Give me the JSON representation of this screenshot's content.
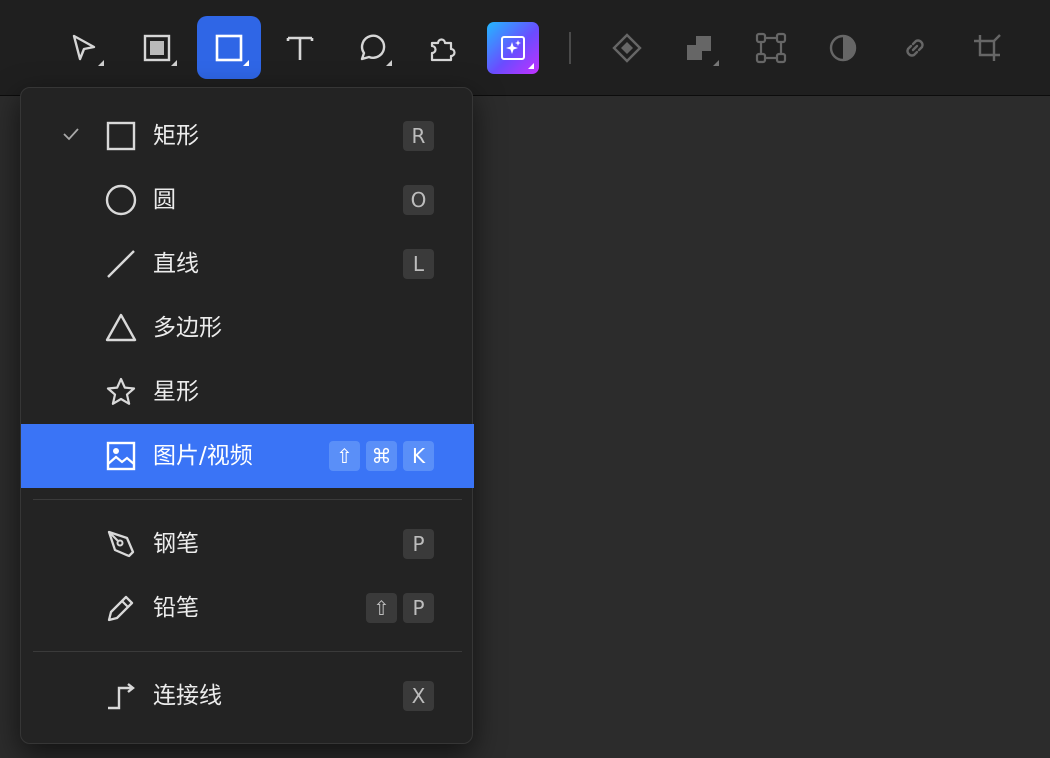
{
  "toolbar": {
    "tools": [
      {
        "name": "select-tool",
        "icon": "cursor-arrow-icon",
        "has_dropdown": true
      },
      {
        "name": "frame-tool",
        "icon": "frame-icon",
        "has_dropdown": true
      },
      {
        "name": "rectangle-tool",
        "icon": "square-icon",
        "has_dropdown": true,
        "active": true
      },
      {
        "name": "text-tool",
        "icon": "text-icon",
        "has_dropdown": false
      },
      {
        "name": "comment-tool",
        "icon": "speech-bubble-icon",
        "has_dropdown": true
      },
      {
        "name": "plugin-tool",
        "icon": "puzzle-icon",
        "has_dropdown": false
      },
      {
        "name": "ai-tool",
        "icon": "magic-sparkle-icon",
        "has_dropdown": true
      }
    ],
    "right_tools": [
      {
        "name": "component-tool",
        "icon": "diamond-icon",
        "has_dropdown": false
      },
      {
        "name": "boolean-tool",
        "icon": "boolean-union-icon",
        "has_dropdown": true
      },
      {
        "name": "vector-edit-tool",
        "icon": "bounding-box-icon",
        "has_dropdown": false
      },
      {
        "name": "mask-tool",
        "icon": "half-circle-icon",
        "has_dropdown": false
      },
      {
        "name": "link-tool",
        "icon": "link-icon",
        "has_dropdown": false
      },
      {
        "name": "crop-tool",
        "icon": "crop-icon",
        "has_dropdown": false
      }
    ]
  },
  "menu": {
    "items": [
      {
        "label": "矩形",
        "icon": "rectangle-icon",
        "keys": [
          "R"
        ],
        "checked": true,
        "highlighted": false
      },
      {
        "label": "圆",
        "icon": "circle-icon",
        "keys": [
          "O"
        ],
        "checked": false,
        "highlighted": false
      },
      {
        "label": "直线",
        "icon": "line-icon",
        "keys": [
          "L"
        ],
        "checked": false,
        "highlighted": false
      },
      {
        "label": "多边形",
        "icon": "triangle-icon",
        "keys": [],
        "checked": false,
        "highlighted": false
      },
      {
        "label": "星形",
        "icon": "star-icon",
        "keys": [],
        "checked": false,
        "highlighted": false
      },
      {
        "label": "图片/视频",
        "icon": "image-icon",
        "keys": [
          "⇧",
          "⌘",
          "K"
        ],
        "checked": false,
        "highlighted": true
      },
      {
        "label": "钢笔",
        "icon": "pen-icon",
        "keys": [
          "P"
        ],
        "checked": false,
        "highlighted": false
      },
      {
        "label": "铅笔",
        "icon": "pencil-icon",
        "keys": [
          "⇧",
          "P"
        ],
        "checked": false,
        "highlighted": false
      },
      {
        "label": "连接线",
        "icon": "connector-icon",
        "keys": [
          "X"
        ],
        "checked": false,
        "highlighted": false
      }
    ]
  },
  "colors": {
    "accent": "#2f66e6",
    "menu_highlight": "#3a74f6",
    "toolbar_bg": "#1f1f1f",
    "canvas_bg": "#2c2c2c",
    "menu_bg": "#232323"
  }
}
